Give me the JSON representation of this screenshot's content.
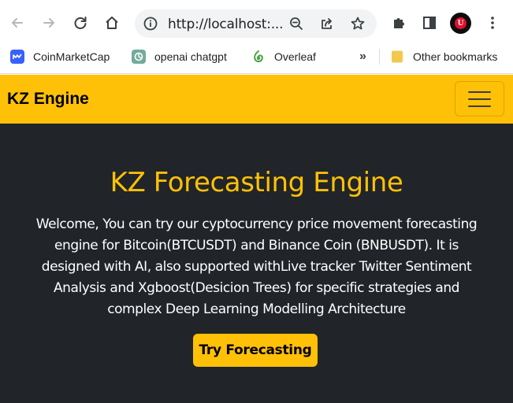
{
  "browser": {
    "url": "http://localhost:...",
    "bookmarks": [
      {
        "label": "CoinMarketCap",
        "icon": "coinmarketcap-icon"
      },
      {
        "label": "openai chatgpt",
        "icon": "openai-icon"
      },
      {
        "label": "Overleaf",
        "icon": "overleaf-icon"
      }
    ],
    "overflow_label": "»",
    "other_bookmarks": "Other bookmarks",
    "profile_initial": "U"
  },
  "navbar": {
    "brand": "KZ Engine"
  },
  "hero": {
    "title": "KZ Forecasting Engine",
    "lines": [
      "Welcome, You can try our cyptocurrency price movement forecasting",
      "engine for Bitcoin(BTCUSDT) and Binance Coin (BNBUSDT). It is",
      "designed with AI, also supported withLive tracker Twitter Sentiment",
      "Analysis and Xgboost(Desicion Trees) for specific strategies and",
      "complex Deep Learning Modelling Architecture"
    ],
    "button_label": "Try Forecasting"
  },
  "colors": {
    "accent": "#ffc107",
    "hero_bg": "#212529",
    "hero_text": "#ffffff"
  }
}
